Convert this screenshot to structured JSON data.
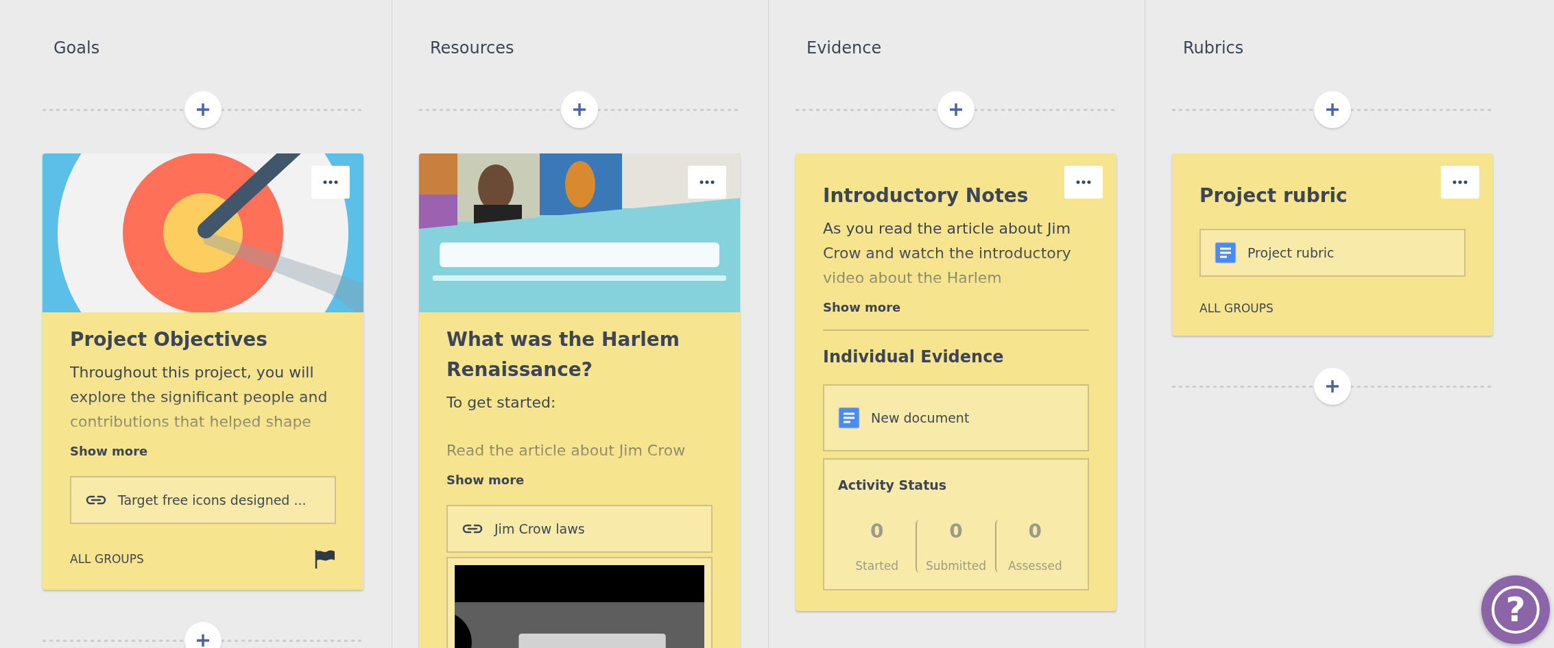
{
  "columns": [
    {
      "title": "Goals",
      "add_below": true,
      "cards": [
        {
          "media": {
            "kind": "target"
          },
          "blocks": [
            {
              "kind": "title",
              "text": "Project Objectives"
            },
            {
              "kind": "text",
              "paragraphs": [
                "Throughout this project, you will explore the significant people and contributions that helped shape"
              ]
            },
            {
              "kind": "show_more",
              "text": "Show more"
            },
            {
              "kind": "link",
              "text": "Target free icons designed ..."
            },
            {
              "kind": "footer",
              "text": "ALL GROUPS",
              "flag": true
            }
          ]
        }
      ]
    },
    {
      "title": "Resources",
      "add_below": false,
      "cards": [
        {
          "media": {
            "kind": "banner"
          },
          "blocks": [
            {
              "kind": "title",
              "text": "What was the Harlem Renaissance?"
            },
            {
              "kind": "text",
              "paragraphs": [
                "To get started:",
                "Read the article about Jim Crow"
              ]
            },
            {
              "kind": "show_more",
              "text": "Show more"
            },
            {
              "kind": "link",
              "text": "Jim Crow laws"
            },
            {
              "kind": "video"
            }
          ]
        }
      ]
    },
    {
      "title": "Evidence",
      "add_below": false,
      "cards": [
        {
          "blocks": [
            {
              "kind": "title",
              "text": "Introductory Notes"
            },
            {
              "kind": "text",
              "paragraphs": [
                "As you read the article about Jim Crow and watch the introductory video about the Harlem"
              ]
            },
            {
              "kind": "show_more",
              "text": "Show more"
            },
            {
              "kind": "divider"
            },
            {
              "kind": "heading",
              "text": "Individual Evidence"
            },
            {
              "kind": "doc",
              "text": "New document",
              "tall": true
            },
            {
              "kind": "status",
              "title": "Activity Status",
              "stats": [
                {
                  "value": "0",
                  "label": "Started"
                },
                {
                  "value": "0",
                  "label": "Submitted"
                },
                {
                  "value": "0",
                  "label": "Assessed"
                }
              ]
            }
          ]
        }
      ]
    },
    {
      "title": "Rubrics",
      "add_below": true,
      "cards": [
        {
          "blocks": [
            {
              "kind": "title",
              "text": "Project rubric"
            },
            {
              "kind": "doc",
              "text": "Project rubric",
              "tall": false
            },
            {
              "kind": "footer",
              "text": "ALL GROUPS",
              "flag": false
            }
          ]
        }
      ]
    }
  ],
  "help_button": {
    "label": "?"
  }
}
